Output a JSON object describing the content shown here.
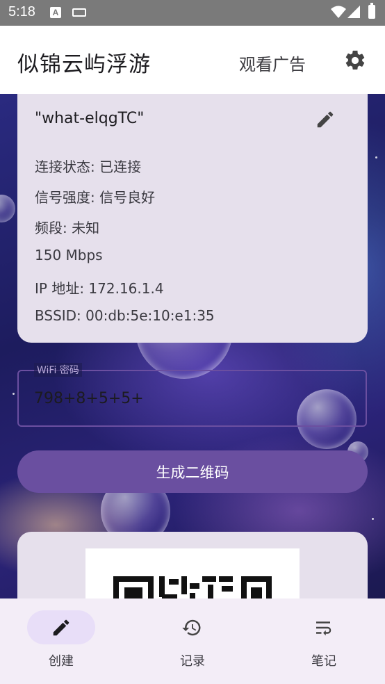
{
  "status_bar": {
    "time": "5:18",
    "notif_icon_letter": "A"
  },
  "app_bar": {
    "title": "似锦云屿浮游",
    "ad_button": "观看广告",
    "settings_icon": "gear-icon"
  },
  "wifi_info": {
    "ssid": "\"what-elqgTC\"",
    "connection_status": "连接状态: 已连接",
    "signal_strength": "信号强度: 信号良好",
    "band": "频段: 未知",
    "speed": "150 Mbps",
    "ip_address": "IP 地址: 172.16.1.4",
    "bssid": "BSSID: 00:db:5e:10:e1:35"
  },
  "password_field": {
    "label": "WiFi 密码",
    "value": "798+8+5+5+"
  },
  "generate_button": "生成二维码",
  "bottom_nav": {
    "items": [
      {
        "label": "创建",
        "icon": "pencil-icon",
        "active": true
      },
      {
        "label": "记录",
        "icon": "history-icon",
        "active": false
      },
      {
        "label": "笔记",
        "icon": "wrap-text-icon",
        "active": false
      }
    ]
  },
  "colors": {
    "primary": "#6a4fa0",
    "card": "#e6e0ec",
    "nav_bg": "#f3edf7",
    "nav_active": "#e8def8"
  }
}
